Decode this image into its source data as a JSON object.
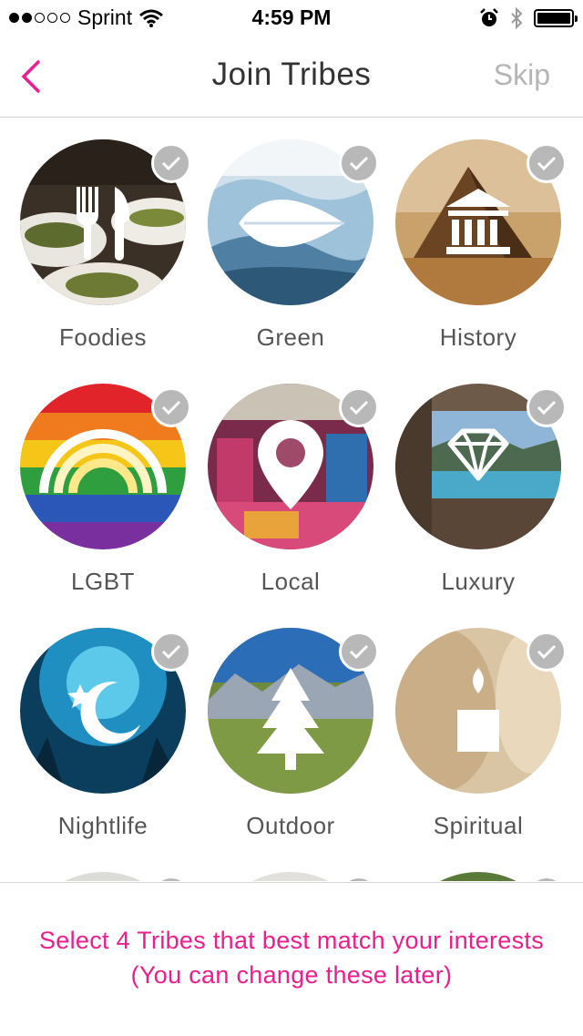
{
  "status_bar": {
    "carrier": "Sprint",
    "time": "4:59 PM",
    "signal_dots": [
      true,
      true,
      false,
      false,
      false
    ]
  },
  "nav": {
    "title": "Join Tribes",
    "skip_label": "Skip",
    "accent_color": "#ec1d8c"
  },
  "tribes": [
    {
      "label": "Foodies",
      "icon": "fork-knife-icon",
      "selected": false
    },
    {
      "label": "Green",
      "icon": "leaf-icon",
      "selected": false
    },
    {
      "label": "History",
      "icon": "museum-icon",
      "selected": false
    },
    {
      "label": "LGBT",
      "icon": "rainbow-icon",
      "selected": false
    },
    {
      "label": "Local",
      "icon": "map-pin-icon",
      "selected": false
    },
    {
      "label": "Luxury",
      "icon": "diamond-icon",
      "selected": false
    },
    {
      "label": "Nightlife",
      "icon": "moon-star-icon",
      "selected": false
    },
    {
      "label": "Outdoor",
      "icon": "pine-tree-icon",
      "selected": false
    },
    {
      "label": "Spiritual",
      "icon": "candle-icon",
      "selected": false
    }
  ],
  "footer": {
    "message": "Select 4 Tribes that best match your interests (You can change these later)"
  }
}
